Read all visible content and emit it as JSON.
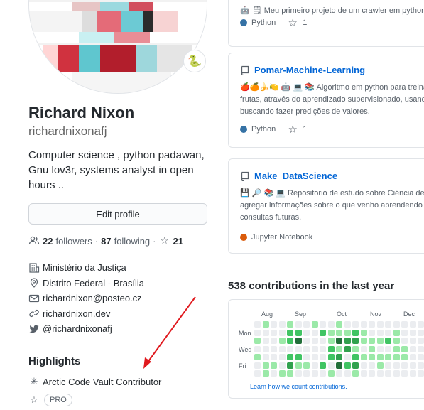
{
  "profile": {
    "name": "Richard Nixon",
    "login": "richardnixonafj",
    "bio": "Computer science , python padawan, Gnu lov3r, systems analyst in open hours ..",
    "edit_label": "Edit profile",
    "status_emoji": "🐍",
    "followers_count": "22",
    "followers_label": "followers",
    "following_count": "87",
    "following_label": "following",
    "stars_count": "21",
    "dot_sep": "·",
    "details": {
      "company": "Ministério da Justiça",
      "location": "Distrito Federal - Brasília",
      "email": "richardnixon@posteo.cz",
      "website": "richardnixon.dev",
      "twitter": "@richardnixonafj"
    }
  },
  "highlights": {
    "title": "Highlights",
    "items": [
      "Arctic Code Vault Contributor",
      "PRO"
    ]
  },
  "repos": [
    {
      "name": "",
      "description": "🤖 🗒 Meu primeiro projeto de um crawler em python",
      "language": "Python",
      "language_color": "#3572A5",
      "stars": "1"
    },
    {
      "name": "Pomar-Machine-Learning",
      "description_lines": [
        "🍎🍊🍌🍋 🤖 💻 📚 Algoritmo em python para treinar a",
        "frutas, através do aprendizado supervisionado, usando",
        "buscando fazer predições de valores."
      ],
      "language": "Python",
      "language_color": "#3572A5",
      "stars": "1"
    },
    {
      "name": "Make_DataScience",
      "description_lines": [
        "💾 🔎 📚 💻 Repositorio de estudo sobre Ciência de Da",
        "agregar informações sobre o que venho aprendendo e",
        "consultas futuras."
      ],
      "language": "Jupyter Notebook",
      "language_color": "#DA5B0B"
    }
  ],
  "contributions": {
    "title": "538 contributions in the last year",
    "months": [
      "Aug",
      "Sep",
      "Oct",
      "Nov",
      "Dec"
    ],
    "days": [
      "Mon",
      "Wed",
      "Fri"
    ],
    "learn_link": "Learn how we count contributions.",
    "colors": [
      "#ebedf0",
      "#9be9a8",
      "#40c463",
      "#30a14e",
      "#216e39"
    ]
  }
}
